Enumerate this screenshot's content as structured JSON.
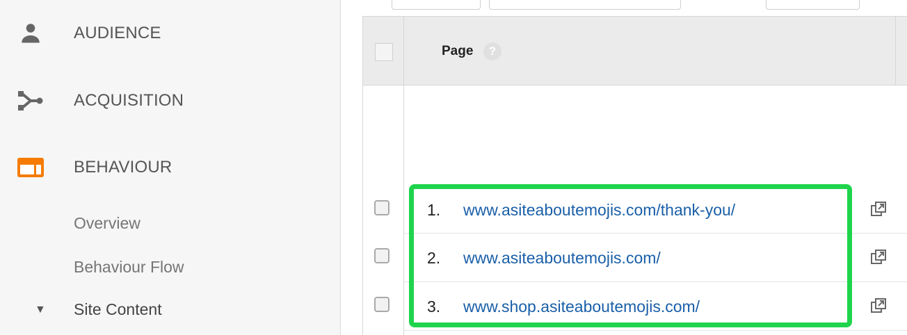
{
  "sidebar": {
    "items": [
      {
        "label": "AUDIENCE",
        "icon": "person-icon"
      },
      {
        "label": "ACQUISITION",
        "icon": "acquisition-icon"
      },
      {
        "label": "BEHAVIOUR",
        "icon": "behaviour-icon",
        "color": "#f57c00"
      }
    ],
    "behaviour_sub": [
      "Overview",
      "Behaviour Flow"
    ],
    "site_content": {
      "toggle": "▼",
      "label": "Site Content"
    }
  },
  "table": {
    "header": {
      "page_label": "Page",
      "help": "?"
    },
    "rows": [
      {
        "index": "1.",
        "url": "www.asiteaboutemojis.com/thank-you/"
      },
      {
        "index": "2.",
        "url": "www.asiteaboutemojis.com/"
      },
      {
        "index": "3.",
        "url": "www.shop.asiteaboutemojis.com/"
      }
    ]
  },
  "colors": {
    "highlight": "#1fd44c",
    "link": "#1a5fa8",
    "behaviour": "#f57c00"
  }
}
